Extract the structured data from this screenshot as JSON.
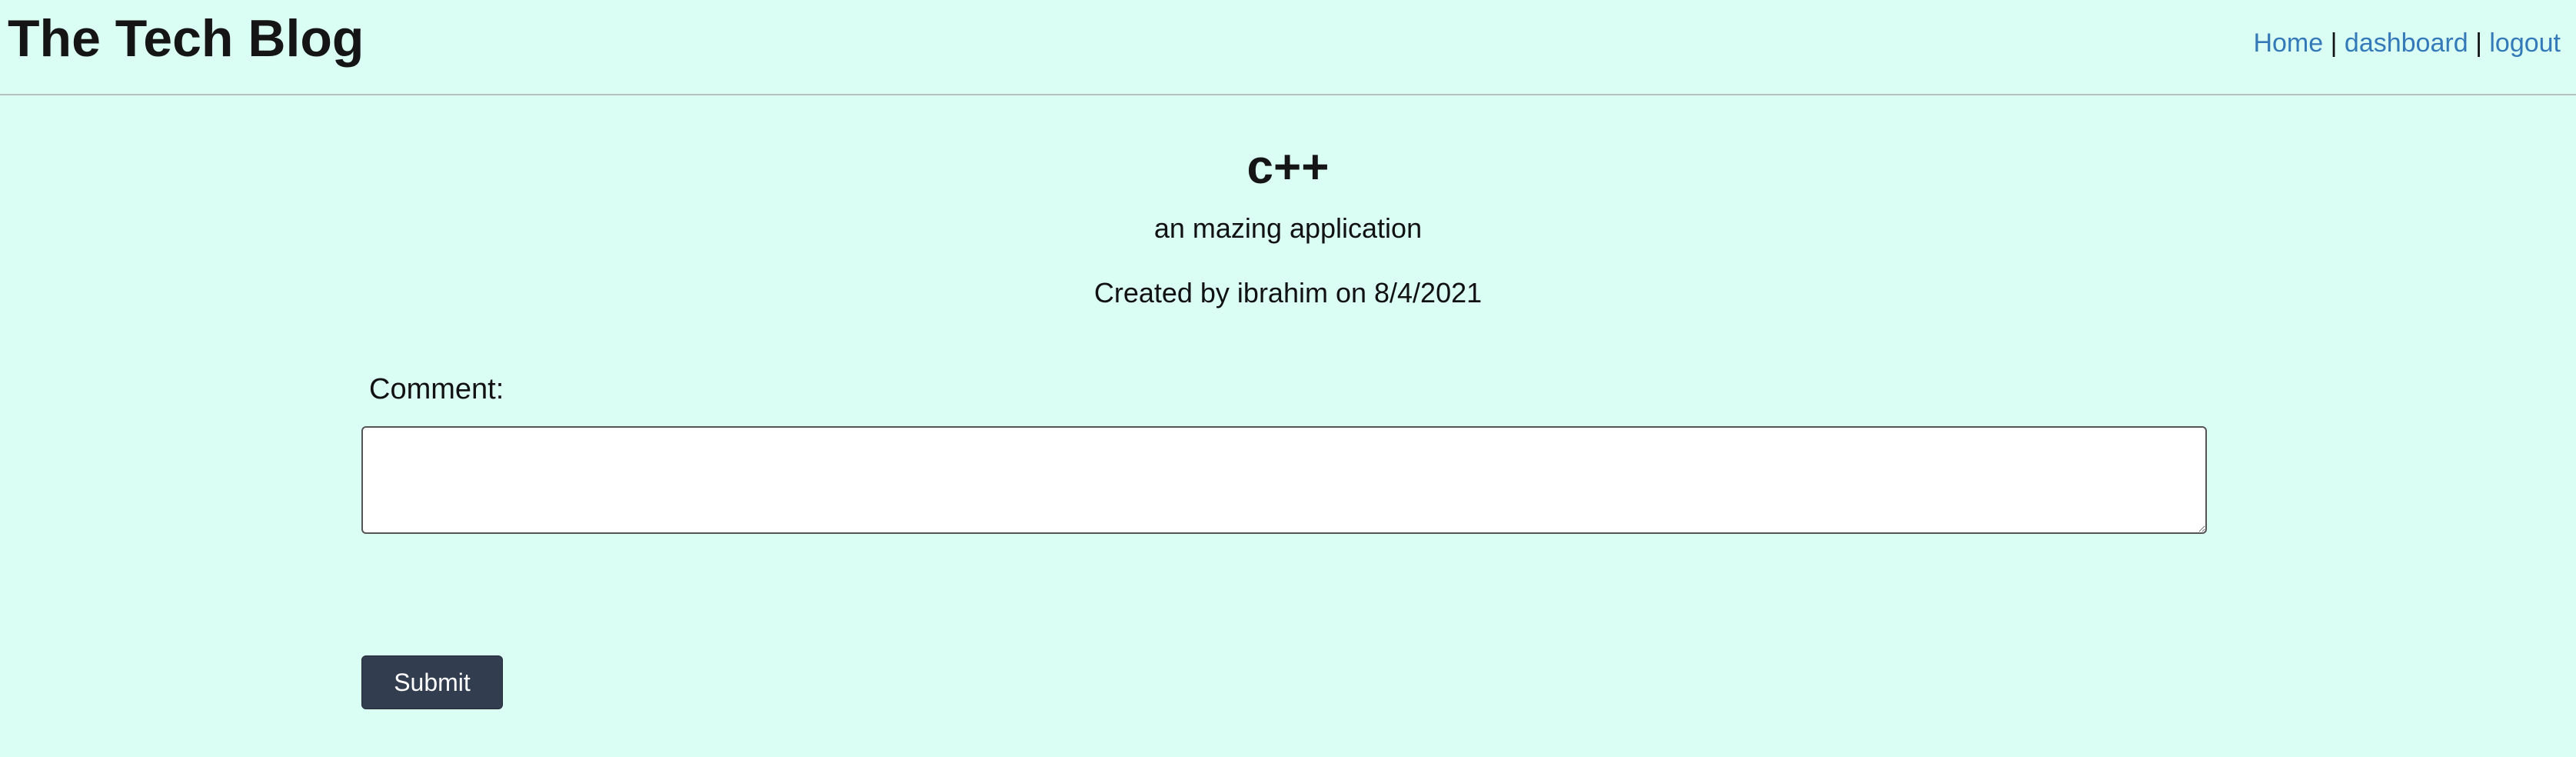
{
  "header": {
    "site_title": "The Tech Blog",
    "nav": {
      "home_label": "Home",
      "separator": "|",
      "dashboard_label": "dashboard",
      "logout_label": "logout"
    }
  },
  "post": {
    "title": "c++",
    "body": "an mazing application",
    "meta": "Created by ibrahim on 8/4/2021"
  },
  "comment_form": {
    "label": "Comment:",
    "input_value": "",
    "submit_label": "Submit"
  },
  "colors": {
    "background": "#dafef4",
    "link": "#3479b8",
    "button": "#323e50",
    "text": "#111111"
  }
}
